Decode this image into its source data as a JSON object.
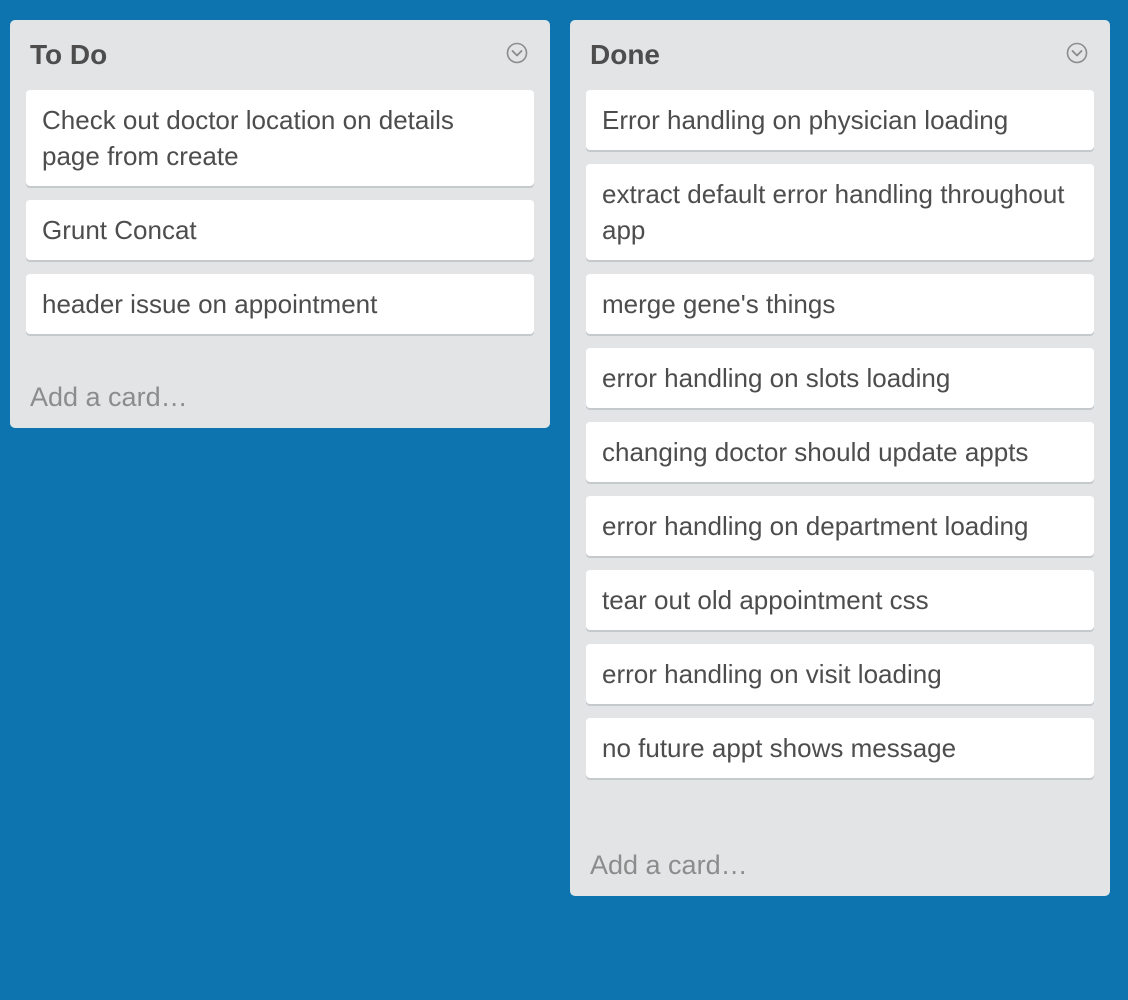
{
  "board": {
    "lists": [
      {
        "title": "To Do",
        "menu_icon": "chevron-down-circle-icon",
        "cards": [
          "Check out doctor location on details page from create",
          "Grunt Concat",
          "header issue on appointment"
        ],
        "add_card_label": "Add a card…"
      },
      {
        "title": "Done",
        "menu_icon": "chevron-down-circle-icon",
        "cards": [
          "Error handling on physician loading",
          "extract default error handling throughout app",
          "merge gene's things",
          "error handling on slots loading",
          "changing doctor should update appts",
          "error handling on department loading",
          "tear out old appointment css",
          "error handling on visit loading",
          "no future appt shows message"
        ],
        "add_card_label": "Add a card…"
      }
    ]
  },
  "colors": {
    "background": "#0e74b0",
    "list_background": "#e2e4e6",
    "card_background": "#ffffff",
    "text": "#4d4d4d",
    "muted_text": "#8c8c8c"
  }
}
